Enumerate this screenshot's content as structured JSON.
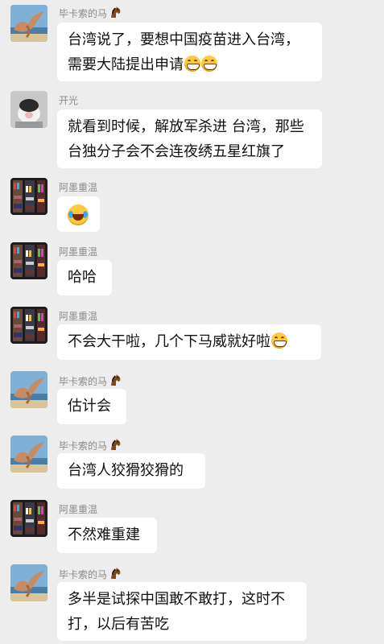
{
  "messages": [
    {
      "sender": "毕卡索的马",
      "avatar": "hand-bird-avatar",
      "lines": [
        "台湾说了，要想中国疫苗进入台湾，",
        "需要大陆提出申请"
      ],
      "trailing_emoji": [
        "grin-emoji",
        "grin-emoji"
      ]
    },
    {
      "sender": "开光",
      "avatar": "cat-avatar",
      "lines": [
        "就看到时候，解放军杀进 台湾，那些",
        "台独分子会不会连夜绣五星红旗了"
      ]
    },
    {
      "sender": "阿墨重温",
      "avatar": "shelf-avatar",
      "lines": [
        ""
      ],
      "emoji": "laugh-cry-emoji"
    },
    {
      "sender": "阿墨重温",
      "avatar": "shelf-avatar",
      "lines": [
        "哈哈"
      ]
    },
    {
      "sender": "阿墨重温",
      "avatar": "shelf-avatar",
      "lines": [
        "不会大干啦，几个下马威就好啦"
      ],
      "trailing_emoji": [
        "grin-emoji"
      ]
    },
    {
      "sender": "毕卡索的马",
      "avatar": "hand-bird-avatar",
      "lines": [
        "估计会"
      ]
    },
    {
      "sender": "毕卡索的马",
      "avatar": "hand-bird-avatar",
      "lines": [
        "台湾人狡猾狡猾的"
      ]
    },
    {
      "sender": "阿墨重温",
      "avatar": "shelf-avatar",
      "lines": [
        "不然难重建"
      ]
    },
    {
      "sender": "毕卡索的马",
      "avatar": "hand-bird-avatar",
      "lines": [
        "多半是试探中国敢不敢打，这时不",
        "打，以后有苦吃"
      ]
    }
  ]
}
